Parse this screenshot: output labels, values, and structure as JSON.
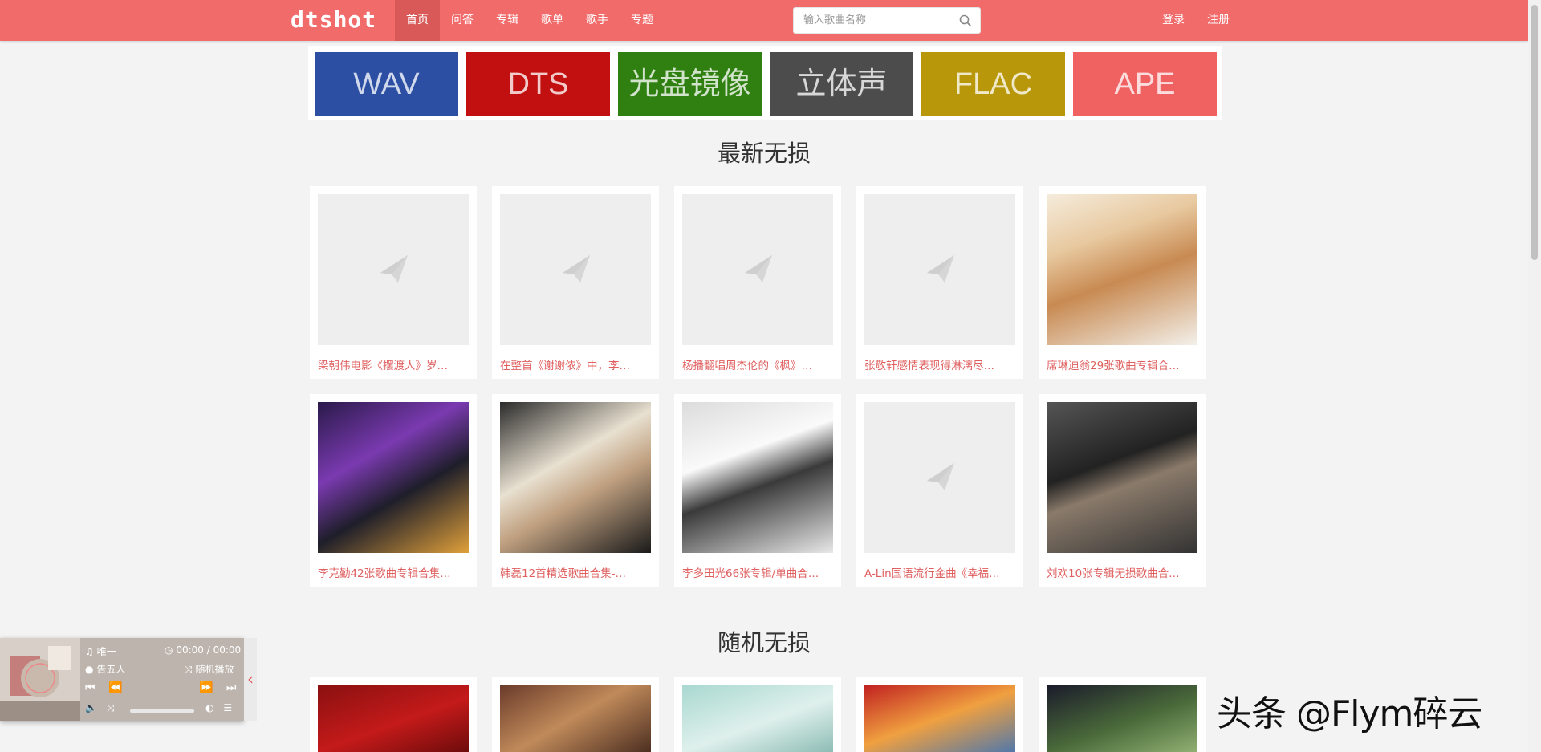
{
  "header": {
    "logo": "dtshot",
    "nav": [
      "首页",
      "问答",
      "专辑",
      "歌单",
      "歌手",
      "专题"
    ],
    "search_placeholder": "输入歌曲名称",
    "login": "登录",
    "register": "注册"
  },
  "formats": [
    {
      "label": "WAV",
      "color": "#2c4fa3"
    },
    {
      "label": "DTS",
      "color": "#c20f0f"
    },
    {
      "label": "光盘镜像",
      "color": "#2f8011"
    },
    {
      "label": "立体声",
      "color": "#4c4c4c"
    },
    {
      "label": "FLAC",
      "color": "#b8980a"
    },
    {
      "label": "APE",
      "color": "#f06262"
    }
  ],
  "sections": {
    "latest": "最新无损",
    "random": "随机无损"
  },
  "latest_cards": [
    {
      "caption": "梁朝伟电影《摆渡人》岁…",
      "cover": "placeholder"
    },
    {
      "caption": "在整首《谢谢侬》中，李…",
      "cover": "placeholder"
    },
    {
      "caption": "杨播翻唱周杰伦的《枫》…",
      "cover": "placeholder"
    },
    {
      "caption": "张敬轩感情表现得淋漓尽…",
      "cover": "placeholder"
    },
    {
      "caption": "席琳迪翁29张歌曲专辑合…",
      "cover": "photo"
    },
    {
      "caption": "李克勤42张歌曲专辑合集…",
      "cover": "photo"
    },
    {
      "caption": "韩磊12首精选歌曲合集-…",
      "cover": "photo"
    },
    {
      "caption": "李多田光66张专辑/单曲合…",
      "cover": "photo"
    },
    {
      "caption": "A-Lin国语流行金曲《幸福…",
      "cover": "placeholder"
    },
    {
      "caption": "刘欢10张专辑无损歌曲合…",
      "cover": "photo"
    }
  ],
  "random_cards": [
    {
      "cover": "photo"
    },
    {
      "cover": "photo"
    },
    {
      "cover": "photo"
    },
    {
      "cover": "photo"
    },
    {
      "cover": "photo"
    }
  ],
  "player": {
    "song": "唯一",
    "time": "00:00 / 00:00",
    "artist": "告五人",
    "mode": "随机播放",
    "progress": 0
  },
  "watermark": "头条 @Flym碎云"
}
